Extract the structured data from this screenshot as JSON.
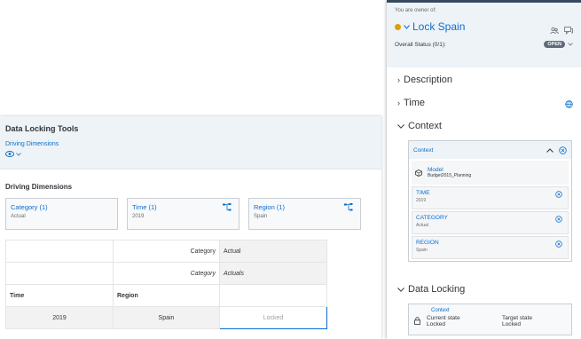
{
  "tools": {
    "title": "Data Locking Tools",
    "link": "Driving Dimensions",
    "section_title": "Driving Dimensions",
    "dimensions": [
      {
        "name": "Category (1)",
        "value": "Actual"
      },
      {
        "name": "Time (1)",
        "value": "2019"
      },
      {
        "name": "Region (1)",
        "value": "Spain"
      }
    ],
    "grid": {
      "row1": {
        "label": "Category",
        "value": "Actual"
      },
      "row2": {
        "label": "Category",
        "value": "Actuals"
      },
      "col_time": "Time",
      "col_region": "Region",
      "data": {
        "time": "2019",
        "region": "Spain",
        "state": "Locked"
      }
    }
  },
  "side": {
    "owner_text": "You are owner of:",
    "lock_name": "Lock Spain",
    "status_label": "Overall Status (0/1):",
    "status_badge": "OPEN",
    "sections": {
      "description": "Description",
      "time": "Time",
      "context": "Context",
      "data_locking": "Data Locking"
    },
    "context_box": {
      "title": "Context",
      "model_label": "Model",
      "model_value": "Budget2015_Planning",
      "items": [
        {
          "name": "TIME",
          "value": "2019"
        },
        {
          "name": "CATEGORY",
          "value": "Actual"
        },
        {
          "name": "REGION",
          "value": "Spain"
        }
      ]
    },
    "data_locking_box": {
      "context": "Context",
      "current_label": "Current state",
      "current_value": "Locked",
      "target_label": "Target state",
      "target_value": "Locked"
    }
  },
  "colors": {
    "accent": "#0a6ed1",
    "status_dot": "#e09d00",
    "header_bg": "#eef3f7"
  }
}
